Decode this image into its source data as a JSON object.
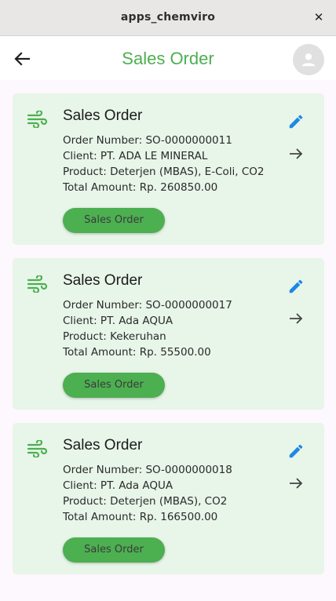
{
  "window": {
    "title": "apps_chemviro",
    "close_glyph": "✕"
  },
  "appbar": {
    "title": "Sales Order",
    "back_icon": "arrow-back-icon",
    "avatar_icon": "person-icon"
  },
  "colors": {
    "accent": "#4caf50",
    "card_bg": "#e8f5e9",
    "edit_icon": "#1e88e5"
  },
  "orders": [
    {
      "title": "Sales Order",
      "order_number": "Order Number: SO-0000000011",
      "client": "Client: PT. ADA LE MINERAL",
      "product": "Product: Deterjen (MBAS), E-Coli, CO2",
      "total": "Total Amount: Rp. 260850.00",
      "button": "Sales Order"
    },
    {
      "title": "Sales Order",
      "order_number": "Order Number: SO-0000000017",
      "client": "Client: PT. Ada AQUA",
      "product": "Product: Kekeruhan",
      "total": "Total Amount: Rp. 55500.00",
      "button": "Sales Order"
    },
    {
      "title": "Sales Order",
      "order_number": "Order Number: SO-0000000018",
      "client": "Client: PT. Ada AQUA",
      "product": "Product: Deterjen (MBAS), CO2",
      "total": "Total Amount: Rp. 166500.00",
      "button": "Sales Order"
    }
  ]
}
